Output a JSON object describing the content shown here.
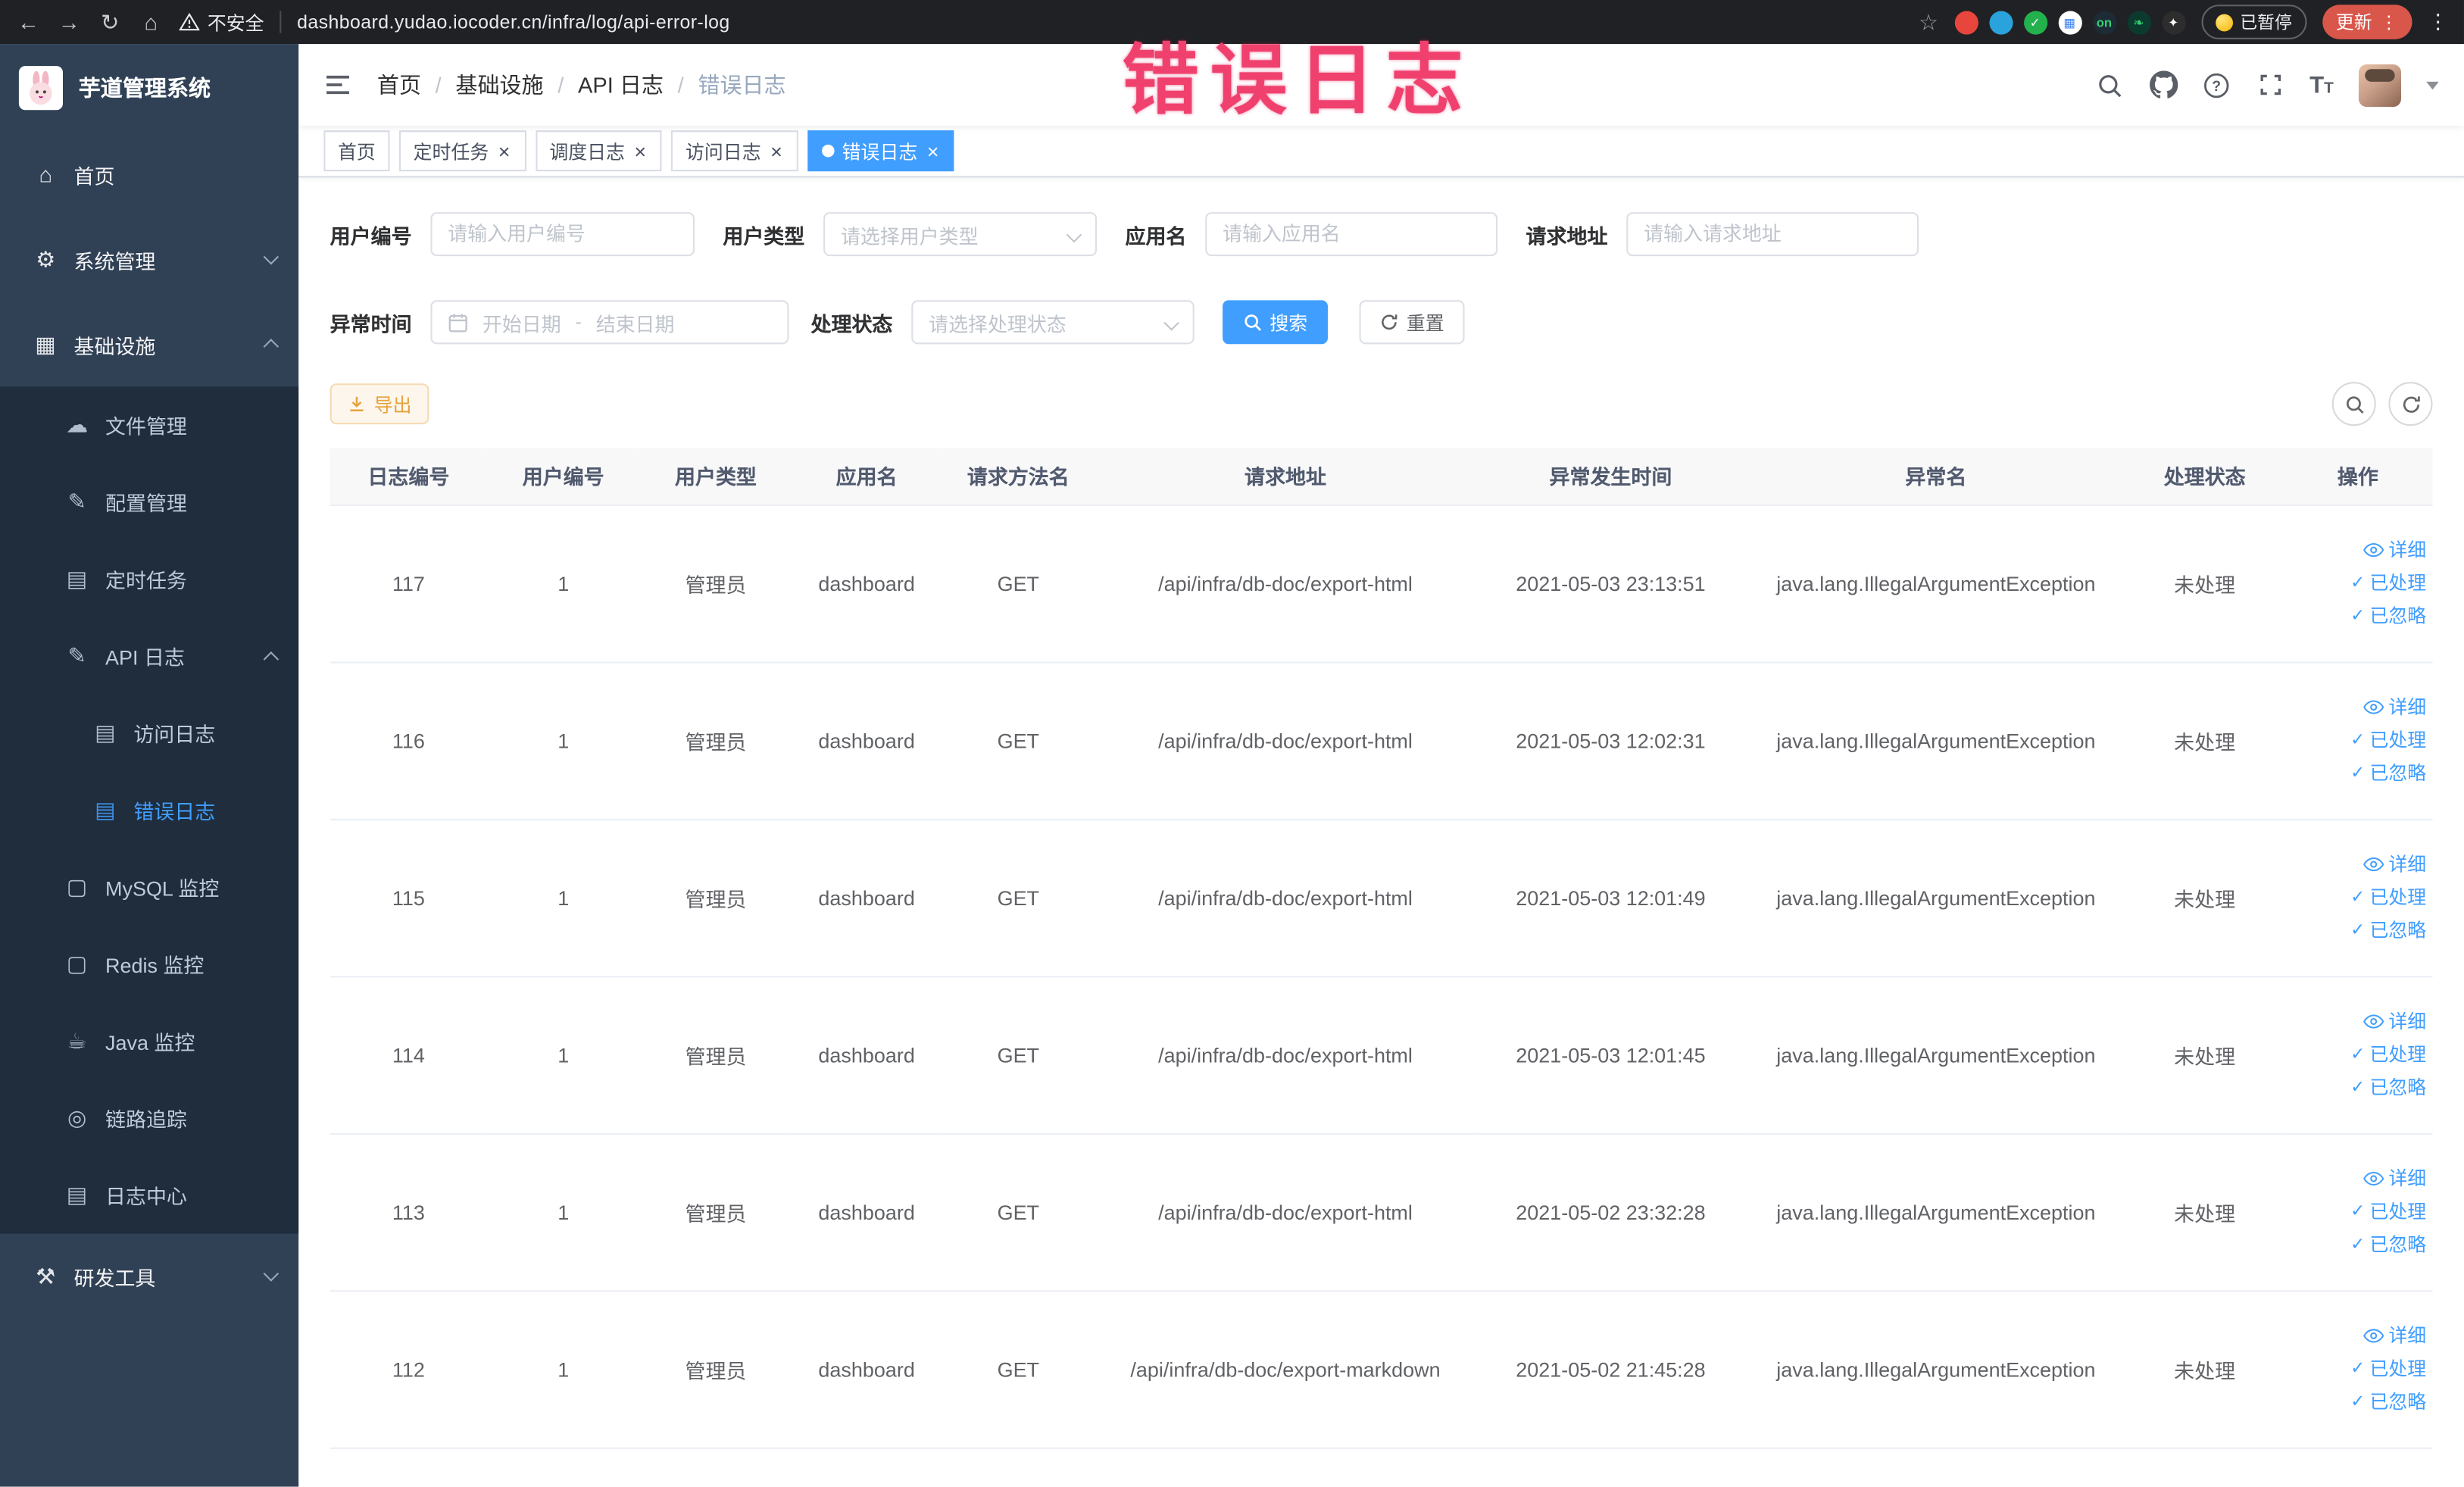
{
  "colors": {
    "accent": "#409eff",
    "warning": "#e6a23c",
    "annotation": "#f0416e",
    "sidebar_bg": "#304156",
    "submenu_bg": "#1f2d3d"
  },
  "annotation": {
    "text": "错误日志"
  },
  "browser": {
    "security_label": "不安全",
    "url": "dashboard.yudao.iocoder.cn/infra/log/api-error-log",
    "paused_badge": "已暂停",
    "update_label": "更新",
    "extension_icons": [
      {
        "name": "red-extension",
        "bg": "#e8453c",
        "glyph": "",
        "fg": "#ffffff"
      },
      {
        "name": "blue-drop-extension",
        "bg": "#2aa3dc",
        "glyph": "",
        "fg": "#ffffff"
      },
      {
        "name": "green-check-extension",
        "bg": "#23b14d",
        "glyph": "✓",
        "fg": "#ffffff"
      },
      {
        "name": "grid-extension",
        "bg": "#ffffff",
        "glyph": "▦",
        "fg": "#4285f4"
      },
      {
        "name": "dark-on-extension",
        "bg": "#1d2b36",
        "glyph": "on",
        "fg": "#35d073"
      },
      {
        "name": "leaf-extension",
        "bg": "#0c3b2e",
        "glyph": "❧",
        "fg": "#35d073"
      },
      {
        "name": "plug-extension",
        "bg": "#2d2d2d",
        "glyph": "✦",
        "fg": "#ffffff"
      }
    ]
  },
  "sidebar": {
    "title": "芋道管理系统",
    "items": [
      {
        "name": "home",
        "label": "首页",
        "icon": "home",
        "level": 0
      },
      {
        "name": "system",
        "label": "系统管理",
        "icon": "gear",
        "level": 0,
        "arrow": "down"
      },
      {
        "name": "infra",
        "label": "基础设施",
        "icon": "grid",
        "level": 0,
        "arrow": "up"
      },
      {
        "name": "file-manage",
        "label": "文件管理",
        "icon": "cloud",
        "level": 1
      },
      {
        "name": "config-manage",
        "label": "配置管理",
        "icon": "edit",
        "level": 1
      },
      {
        "name": "scheduled-task",
        "label": "定时任务",
        "icon": "task",
        "level": 1
      },
      {
        "name": "api-log",
        "label": "API 日志",
        "icon": "log",
        "level": 1,
        "arrow": "up"
      },
      {
        "name": "access-log",
        "label": "访问日志",
        "icon": "doc",
        "level": 2
      },
      {
        "name": "error-log",
        "label": "错误日志",
        "icon": "doc",
        "level": 2,
        "active": true
      },
      {
        "name": "mysql-monitor",
        "label": "MySQL 监控",
        "icon": "monitor",
        "level": 1
      },
      {
        "name": "redis-monitor",
        "label": "Redis 监控",
        "icon": "monitor",
        "level": 1
      },
      {
        "name": "java-monitor",
        "label": "Java 监控",
        "icon": "coffee",
        "level": 1
      },
      {
        "name": "link-trace",
        "label": "链路追踪",
        "icon": "eye",
        "level": 1
      },
      {
        "name": "log-center",
        "label": "日志中心",
        "icon": "doc",
        "level": 1
      },
      {
        "name": "dev-tools",
        "label": "研发工具",
        "icon": "tool",
        "level": 0,
        "arrow": "down"
      }
    ]
  },
  "icon_glyphs": {
    "home": "⌂",
    "gear": "⚙",
    "grid": "▦",
    "cloud": "☁",
    "edit": "✎",
    "task": "▤",
    "log": "✎",
    "doc": "▤",
    "monitor": "▢",
    "coffee": "☕",
    "eye": "◎",
    "tool": "⚒"
  },
  "breadcrumb": {
    "separator": "/",
    "items": [
      "首页",
      "基础设施",
      "API 日志",
      "错误日志"
    ]
  },
  "tabs": [
    {
      "label": "首页",
      "closable": false,
      "active": false
    },
    {
      "label": "定时任务",
      "closable": true,
      "active": false
    },
    {
      "label": "调度日志",
      "closable": true,
      "active": false
    },
    {
      "label": "访问日志",
      "closable": true,
      "active": false
    },
    {
      "label": "错误日志",
      "closable": true,
      "active": true
    }
  ],
  "filters": {
    "user_id": {
      "label": "用户编号",
      "placeholder": "请输入用户编号"
    },
    "user_type": {
      "label": "用户类型",
      "placeholder": "请选择用户类型"
    },
    "app_name": {
      "label": "应用名",
      "placeholder": "请输入应用名"
    },
    "request_url": {
      "label": "请求地址",
      "placeholder": "请输入请求地址"
    },
    "exception_time": {
      "label": "异常时间",
      "start_placeholder": "开始日期",
      "separator": "-",
      "end_placeholder": "结束日期"
    },
    "process_status": {
      "label": "处理状态",
      "placeholder": "请选择处理状态"
    },
    "search_label": "搜索",
    "reset_label": "重置"
  },
  "toolbar": {
    "export_label": "导出"
  },
  "table": {
    "columns": [
      "日志编号",
      "用户编号",
      "用户类型",
      "应用名",
      "请求方法名",
      "请求地址",
      "异常发生时间",
      "异常名",
      "处理状态",
      "操作"
    ],
    "action_labels": {
      "detail": "详细",
      "processed": "已处理",
      "ignored": "已忽略"
    },
    "check_glyph": "✓",
    "rows": [
      {
        "id": "117",
        "user_id": "1",
        "user_type": "管理员",
        "app": "dashboard",
        "method": "GET",
        "url": "/api/infra/db-doc/export-html",
        "time": "2021-05-03 23:13:51",
        "exception": "java.lang.IllegalArgumentException",
        "status": "未处理"
      },
      {
        "id": "116",
        "user_id": "1",
        "user_type": "管理员",
        "app": "dashboard",
        "method": "GET",
        "url": "/api/infra/db-doc/export-html",
        "time": "2021-05-03 12:02:31",
        "exception": "java.lang.IllegalArgumentException",
        "status": "未处理"
      },
      {
        "id": "115",
        "user_id": "1",
        "user_type": "管理员",
        "app": "dashboard",
        "method": "GET",
        "url": "/api/infra/db-doc/export-html",
        "time": "2021-05-03 12:01:49",
        "exception": "java.lang.IllegalArgumentException",
        "status": "未处理"
      },
      {
        "id": "114",
        "user_id": "1",
        "user_type": "管理员",
        "app": "dashboard",
        "method": "GET",
        "url": "/api/infra/db-doc/export-html",
        "time": "2021-05-03 12:01:45",
        "exception": "java.lang.IllegalArgumentException",
        "status": "未处理"
      },
      {
        "id": "113",
        "user_id": "1",
        "user_type": "管理员",
        "app": "dashboard",
        "method": "GET",
        "url": "/api/infra/db-doc/export-html",
        "time": "2021-05-02 23:32:28",
        "exception": "java.lang.IllegalArgumentException",
        "status": "未处理"
      },
      {
        "id": "112",
        "user_id": "1",
        "user_type": "管理员",
        "app": "dashboard",
        "method": "GET",
        "url": "/api/infra/db-doc/export-markdown",
        "time": "2021-05-02 21:45:28",
        "exception": "java.lang.IllegalArgumentException",
        "status": "未处理"
      }
    ]
  }
}
